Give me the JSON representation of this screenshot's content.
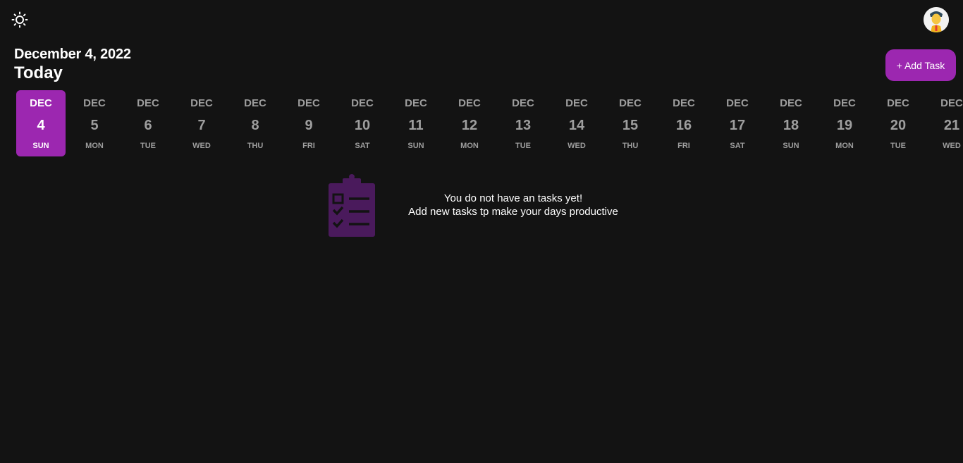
{
  "header": {
    "theme_icon": "sun-icon",
    "avatar_icon": "user-avatar-icon"
  },
  "title": {
    "date": "December 4, 2022",
    "today": "Today"
  },
  "actions": {
    "add_task_label": "+ Add Task"
  },
  "colors": {
    "background": "#131313",
    "accent": "#9c27b0",
    "muted_text": "#9e9e9e",
    "icon_purple": "#4a1a5c"
  },
  "date_strip": {
    "days": [
      {
        "month": "DEC",
        "day": "4",
        "weekday": "SUN",
        "selected": true
      },
      {
        "month": "DEC",
        "day": "5",
        "weekday": "MON"
      },
      {
        "month": "DEC",
        "day": "6",
        "weekday": "TUE"
      },
      {
        "month": "DEC",
        "day": "7",
        "weekday": "WED"
      },
      {
        "month": "DEC",
        "day": "8",
        "weekday": "THU"
      },
      {
        "month": "DEC",
        "day": "9",
        "weekday": "FRI"
      },
      {
        "month": "DEC",
        "day": "10",
        "weekday": "SAT"
      },
      {
        "month": "DEC",
        "day": "11",
        "weekday": "SUN"
      },
      {
        "month": "DEC",
        "day": "12",
        "weekday": "MON"
      },
      {
        "month": "DEC",
        "day": "13",
        "weekday": "TUE"
      },
      {
        "month": "DEC",
        "day": "14",
        "weekday": "WED"
      },
      {
        "month": "DEC",
        "day": "15",
        "weekday": "THU"
      },
      {
        "month": "DEC",
        "day": "16",
        "weekday": "FRI"
      },
      {
        "month": "DEC",
        "day": "17",
        "weekday": "SAT"
      },
      {
        "month": "DEC",
        "day": "18",
        "weekday": "SUN"
      },
      {
        "month": "DEC",
        "day": "19",
        "weekday": "MON"
      },
      {
        "month": "DEC",
        "day": "20",
        "weekday": "TUE"
      },
      {
        "month": "DEC",
        "day": "21",
        "weekday": "WED"
      }
    ]
  },
  "empty_state": {
    "icon": "clipboard-checklist-icon",
    "line1": "You do not have an tasks yet!",
    "line2": "Add new tasks tp make your days productive"
  }
}
